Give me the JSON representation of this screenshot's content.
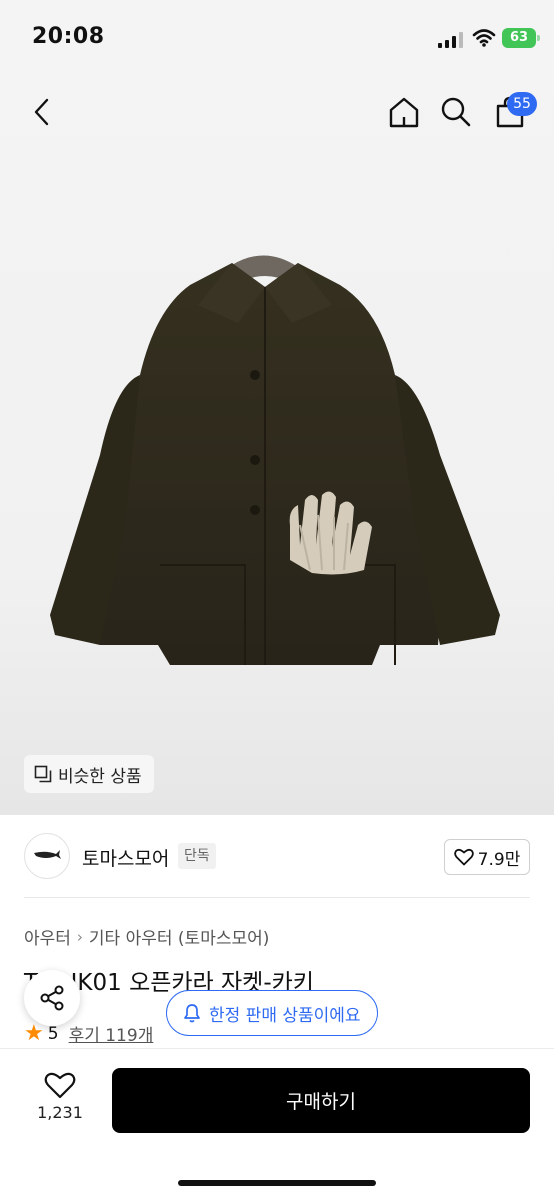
{
  "status_bar": {
    "time": "20:08",
    "battery": "63"
  },
  "header": {
    "cart_count": "55"
  },
  "hero": {
    "similar_label": "비슷한 상품"
  },
  "brand": {
    "name": "토마스모어",
    "tag": "단독",
    "likes": "7.9만"
  },
  "breadcrumb": [
    "아우터",
    "기타 아우터 (토마스모어)"
  ],
  "product": {
    "title": "T**-JK01 오픈카라 자켓-카키",
    "rating": "5",
    "review_label": "후기 119개"
  },
  "notice": {
    "limited_label": "한정 판매 상품이에요"
  },
  "bottom_bar": {
    "wish_count": "1,231",
    "buy_label": "구매하기"
  },
  "colors": {
    "accent": "#2f6bf2",
    "star": "#ff8c00",
    "buy_button": "#000000",
    "battery": "#41c557",
    "jacket": "#2f2b20"
  },
  "icons": [
    "back-icon",
    "home-icon",
    "search-icon",
    "shopping-bag-icon",
    "similar-icon",
    "heart-icon",
    "share-icon",
    "bell-icon",
    "star-icon"
  ]
}
